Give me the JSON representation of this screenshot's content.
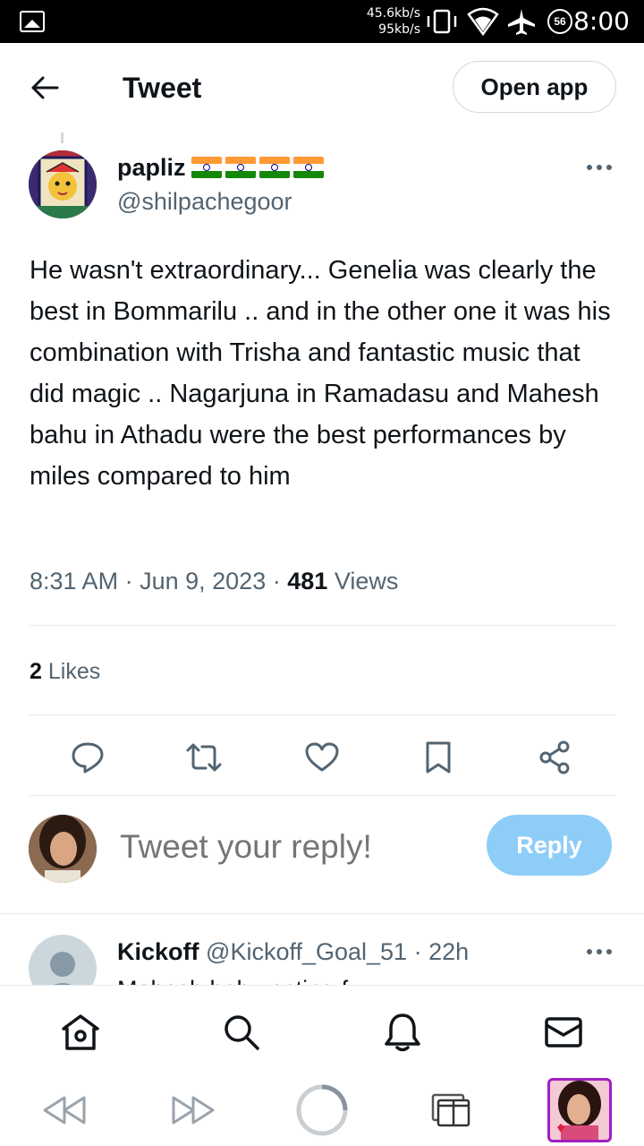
{
  "status_bar": {
    "net_up": "45.6kb/s",
    "net_down": "95kb/s",
    "battery_level": "56",
    "time": "8:00",
    "icons": [
      "gallery-icon",
      "vibrate-icon",
      "wifi-icon",
      "airplane-icon",
      "battery-icon"
    ]
  },
  "header": {
    "title": "Tweet",
    "open_app_label": "Open app"
  },
  "tweet": {
    "display_name": "papliz",
    "flags_count": 4,
    "handle": "@shilpachegoor",
    "text": "He wasn't extraordinary... Genelia was clearly the best in Bommarilu .. and in the other one it was his combination with Trisha and fantastic music that did magic .. Nagarjuna in Ramadasu and Mahesh bahu in Athadu were the best performances by miles compared to him",
    "time": "8:31 AM",
    "date": "Jun 9, 2023",
    "sep": "·",
    "views_count": "481",
    "views_label": "Views",
    "likes_count": "2",
    "likes_label": "Likes"
  },
  "composer": {
    "placeholder": "Tweet your reply!",
    "reply_label": "Reply"
  },
  "next_reply": {
    "display_name": "Kickoff",
    "handle": "@Kickoff_Goal_51",
    "sep": "·",
    "age": "22h",
    "text_peek": "Mahesh babu acting f..."
  },
  "colors": {
    "text_primary": "#0f1419",
    "text_secondary": "#536471",
    "reply_button_disabled": "#8ecdf8",
    "divider": "#e6ecf0"
  }
}
